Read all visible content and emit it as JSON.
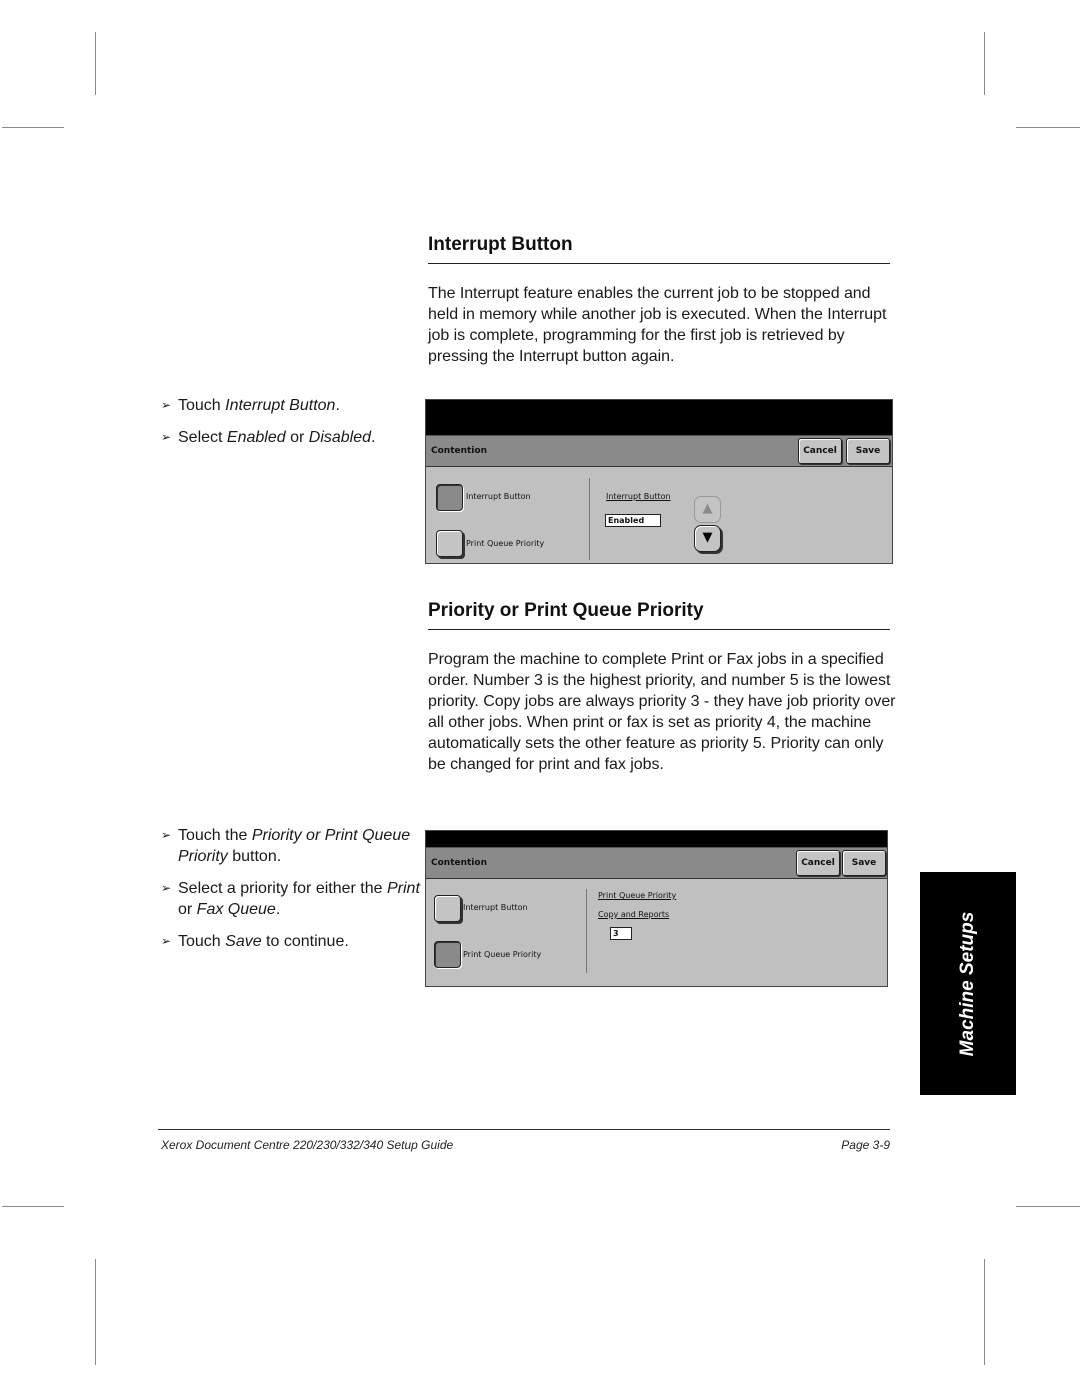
{
  "section1": {
    "title": "Interrupt Button",
    "body": "The Interrupt feature enables the current job to be stopped and held in memory while another job is executed. When the Interrupt job is complete, programming for the first job is retrieved by pressing the Interrupt button again.",
    "steps": [
      {
        "pre": "Touch ",
        "em": "Interrupt Button",
        "post": "."
      },
      {
        "pre": "Select ",
        "em": "Enabled",
        "mid": " or ",
        "em2": "Disabled",
        "post": "."
      }
    ],
    "screen": {
      "header_title": "Contention",
      "cancel_label": "Cancel",
      "save_label": "Save",
      "options": [
        {
          "label": "Interrupt Button",
          "selected": true
        },
        {
          "label": "Print Queue Priority",
          "selected": false
        }
      ],
      "detail_label": "Interrupt Button",
      "detail_value": "Enabled",
      "up_icon": "triangle-up",
      "down_icon": "triangle-down"
    }
  },
  "section2": {
    "title": "Priority or Print Queue Priority",
    "body": "Program the machine to complete Print or Fax jobs in a specified order. Number 3 is the highest priority, and number 5 is the lowest priority. Copy jobs are always priority 3 - they have job priority over all other jobs. When print or fax is set as priority 4, the machine automatically sets the other feature as priority 5. Priority can only be changed for print and fax jobs.",
    "steps": [
      {
        "pre": "Touch the ",
        "em": "Priority or Print Queue Priority",
        "post": " button."
      },
      {
        "pre": "Select a priority for either the ",
        "em": "Print",
        "mid": " or ",
        "em2": "Fax Queue",
        "post": "."
      },
      {
        "pre": "Touch ",
        "em": "Save",
        "post": " to continue."
      }
    ],
    "screen": {
      "header_title": "Contention",
      "cancel_label": "Cancel",
      "save_label": "Save",
      "options": [
        {
          "label": "Interrupt Button",
          "selected": false
        },
        {
          "label": "Print Queue Priority",
          "selected": true
        }
      ],
      "detail_label": "Print Queue Priority",
      "sub_label": "Copy and Reports",
      "detail_value": "3"
    }
  },
  "side_tab": "Machine Setups",
  "footer": {
    "left": "Xerox Document Centre 220/230/332/340 Setup Guide",
    "right": "Page 3-9"
  },
  "bullet_glyph": "➢"
}
